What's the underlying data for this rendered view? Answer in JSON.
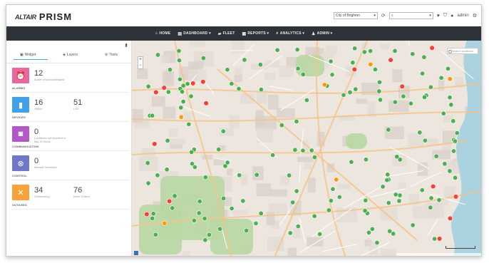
{
  "header": {
    "logo_org": "ALTAIR",
    "logo_product": "PRISM",
    "city_select": "City of Brighton",
    "search_select": "",
    "user_label": "admin"
  },
  "nav": {
    "items": [
      {
        "label": "HOME",
        "icon": "home-icon"
      },
      {
        "label": "DASHBOARD ▾",
        "icon": "dashboard-icon"
      },
      {
        "label": "FLEET",
        "icon": "truck-icon"
      },
      {
        "label": "REPORTS ▾",
        "icon": "reports-icon"
      },
      {
        "label": "ANALYTICS ▾",
        "icon": "analytics-icon"
      },
      {
        "label": "ADMIN ▾",
        "icon": "admin-icon"
      }
    ]
  },
  "sidebar": {
    "tabs": [
      {
        "label": "Widget",
        "icon": "widget-icon"
      },
      {
        "label": "Layers",
        "icon": "layers-icon"
      },
      {
        "label": "Tools",
        "icon": "tools-icon"
      }
    ],
    "cards": [
      {
        "category": "ALARMS",
        "color": "#e9679a",
        "icon": "alarm-icon",
        "value1": "12",
        "label1": "Active unacknowledged",
        "value2": "",
        "label2": ""
      },
      {
        "category": "DEVICES",
        "color": "#3fa1e8",
        "icon": "device-icon",
        "value1": "16",
        "label1": "Offline",
        "value2": "51",
        "label2": "Live"
      },
      {
        "category": "COMMUNICATION",
        "color": "#b258c7",
        "icon": "communication-icon",
        "value1": "0",
        "label1": "Locations not reported in last 24 hours",
        "value2": "",
        "label2": ""
      },
      {
        "category": "CONTROL",
        "color": "#6e77c9",
        "icon": "control-icon",
        "value1": "0",
        "label1": "Manual Overrides",
        "value2": "",
        "label2": ""
      },
      {
        "category": "OUTAGES",
        "color": "#f5a33a",
        "icon": "outage-icon",
        "value1": "34",
        "label1": "Outstanding",
        "value2": "76",
        "label2": "Work Orders"
      }
    ]
  },
  "map": {
    "search_placeholder": "Search locations",
    "marker_colors": {
      "ok": "#4caf50",
      "alarm": "#f44336",
      "warning": "#ff9800"
    },
    "markers": {
      "ok_count": 150,
      "alarm_count": 16,
      "warning_count": 6
    },
    "zoom_in": "+",
    "zoom_out": "−"
  }
}
